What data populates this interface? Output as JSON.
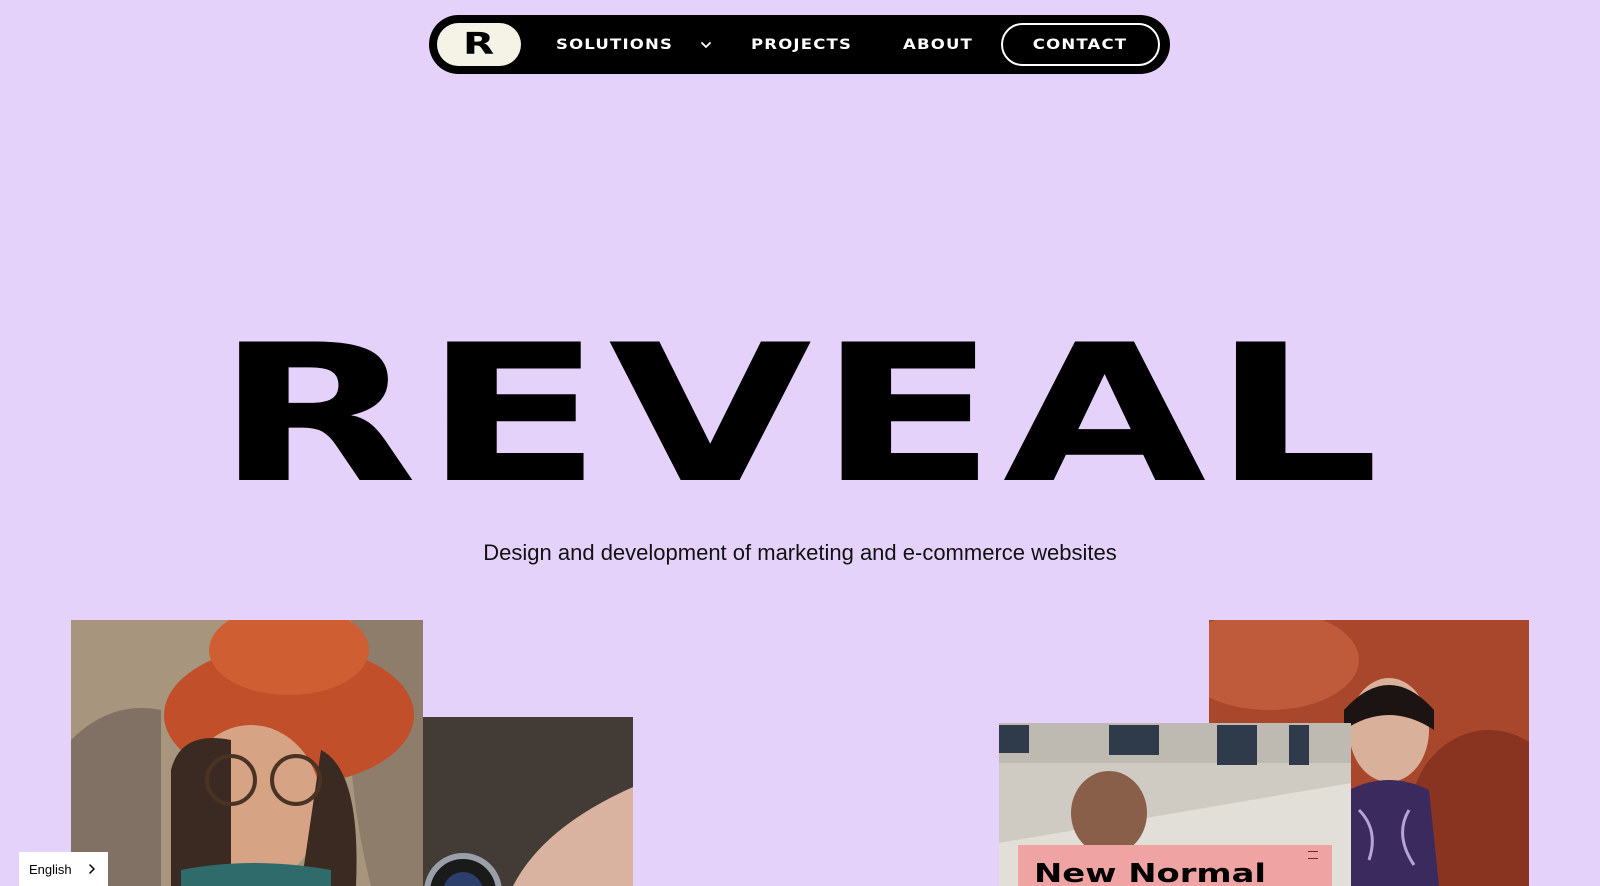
{
  "nav": {
    "logo": "R",
    "items": [
      {
        "label": "SOLUTIONS",
        "has_dropdown": true
      },
      {
        "label": "PROJECTS"
      },
      {
        "label": "ABOUT"
      }
    ],
    "contact_label": "CONTACT"
  },
  "hero": {
    "title": "REVEAL",
    "subtitle": "Design and development of marketing and e-commerce websites"
  },
  "gallery": {
    "promo_card_text": "New Normal"
  },
  "language": {
    "current": "English"
  },
  "colors": {
    "background": "#e4d2fb",
    "nav_background": "#000000",
    "logo_pill": "#f5f2e6",
    "promo_card": "#f0a3a3"
  },
  "icons": {
    "dropdown": "chevron-down-icon",
    "language": "chevron-right-icon"
  }
}
